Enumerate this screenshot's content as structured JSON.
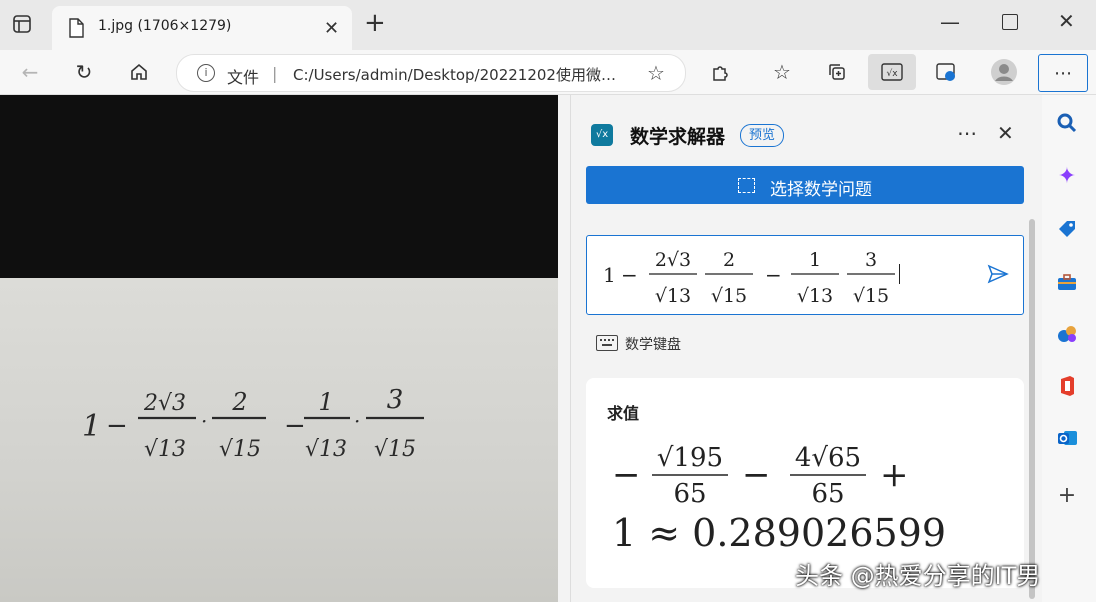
{
  "tab": {
    "title": "1.jpg (1706×1279)"
  },
  "toolbar": {
    "addr_file_label": "文件",
    "addr_separator": "|",
    "addr_url": "C:/Users/admin/Desktop/20221202使用微…"
  },
  "photo": {
    "handwritten": {
      "one": "1",
      "minus": "−",
      "dot": "·",
      "n1": "2√3",
      "d1": "√13",
      "n2": "2",
      "d2": "√15",
      "n3": "1",
      "d3": "√13",
      "n4": "3",
      "d4": "√15"
    }
  },
  "panel": {
    "title": "数学求解器",
    "badge": "预览",
    "select_button": "选择数学问题",
    "keyboard_label": "数学键盘",
    "input": {
      "one": "1",
      "minus": "−",
      "n1": "2√3",
      "d1": "√13",
      "n2": "2",
      "d2": "√15",
      "n3": "1",
      "d3": "√13",
      "n4": "3",
      "d4": "√15"
    },
    "result": {
      "heading": "求值",
      "minus": "−",
      "plus": "+",
      "n1": "√195",
      "d1": "65",
      "n2": "4√65",
      "d2": "65",
      "line2": "1 ≈ 0.289026599"
    }
  },
  "watermark": "头条 @热爱分享的IT男",
  "colors": {
    "accent": "#1a74d2",
    "rail_search": "#1a5fb4",
    "copilot": "#8a3ffc",
    "office": "#e43e2b",
    "outlook": "#0a64c8"
  }
}
